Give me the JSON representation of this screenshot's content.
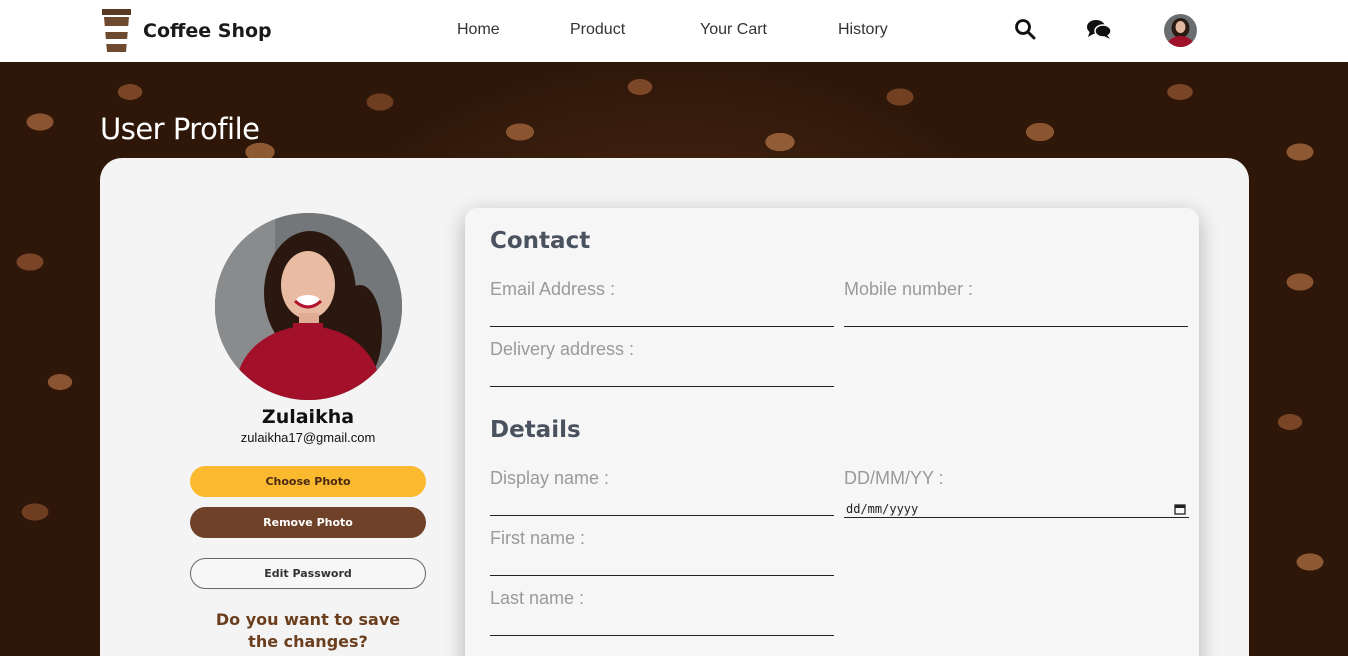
{
  "nav": {
    "brand": "Coffee Shop",
    "links": [
      {
        "label": "Home"
      },
      {
        "label": "Product"
      },
      {
        "label": "Your Cart"
      },
      {
        "label": "History"
      }
    ],
    "icons": [
      "search-icon",
      "chat-icon",
      "user-avatar"
    ]
  },
  "page": {
    "title": "User Profile"
  },
  "profile": {
    "name": "Zulaikha",
    "email": "zulaikha17@gmail.com",
    "choose_photo": "Choose Photo",
    "remove_photo": "Remove Photo",
    "edit_password": "Edit Password",
    "save_question": "Do you want to save the changes?"
  },
  "contact": {
    "title": "Contact",
    "email_label": "Email Address :",
    "mobile_label": "Mobile number :",
    "delivery_label": "Delivery address :"
  },
  "details": {
    "title": "Details",
    "display_name_label": "Display name :",
    "dob_label": "DD/MM/YY :",
    "dob_placeholder": "dd/mm/yyyy",
    "first_name_label": "First name :",
    "last_name_label": "Last name :"
  },
  "colors": {
    "accent_yellow": "#fbb92f",
    "accent_brown": "#6f4128",
    "heading_gray": "#4a5260"
  }
}
